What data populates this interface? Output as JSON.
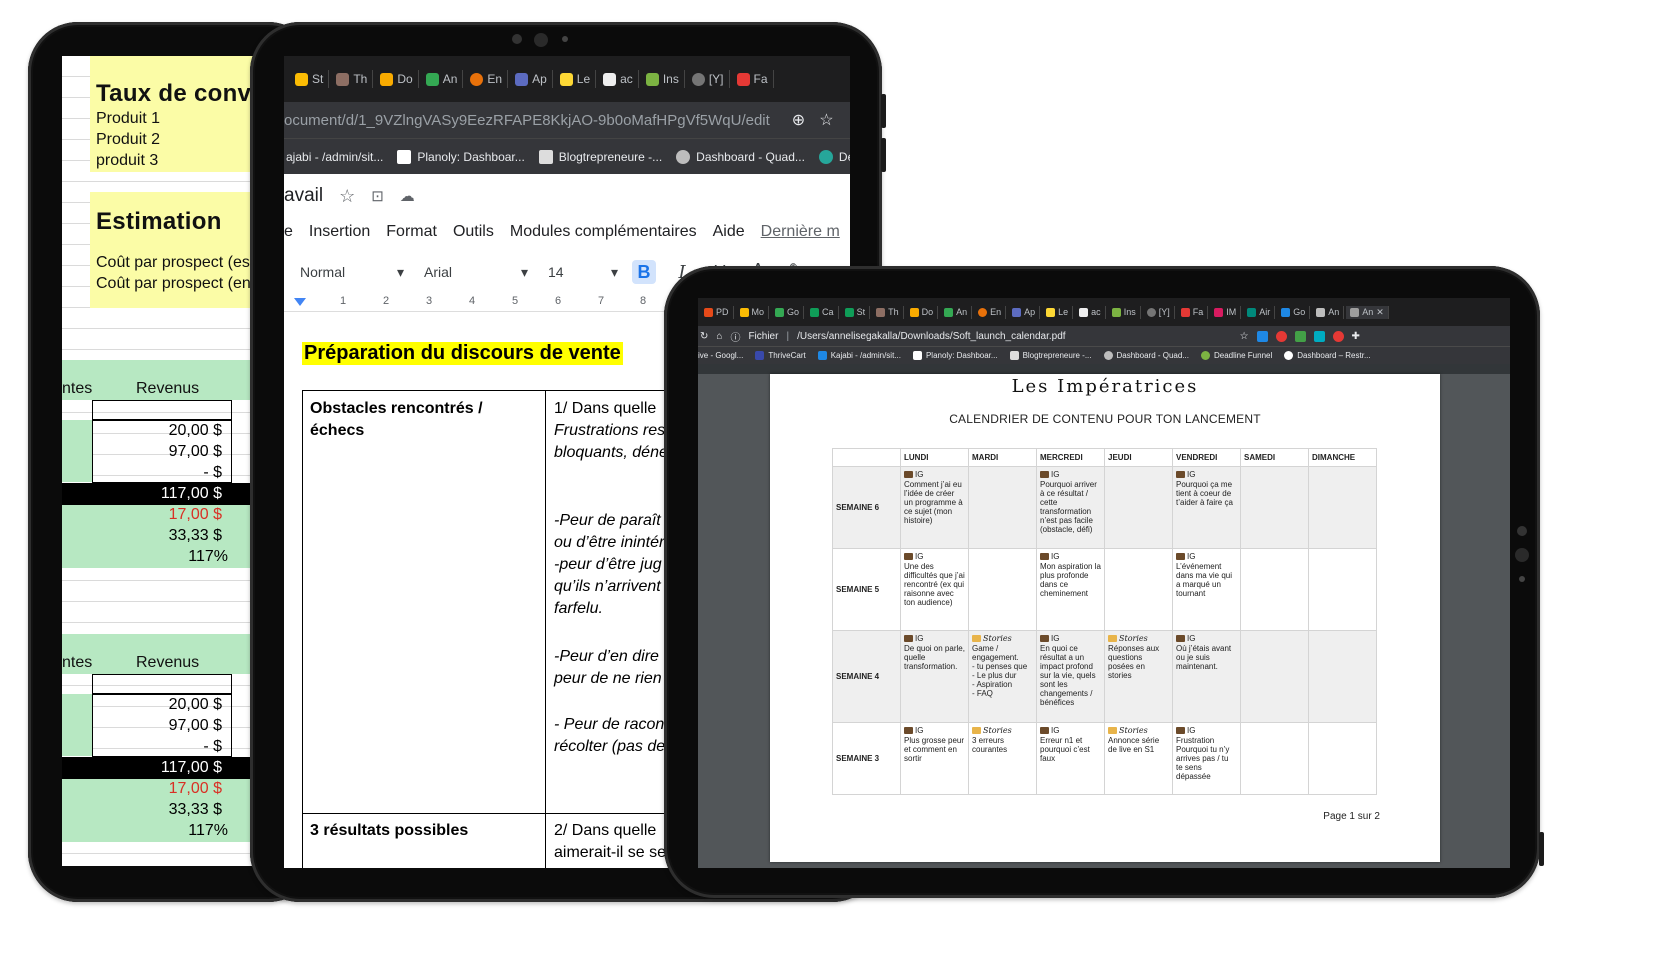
{
  "spreadsheet": {
    "heading_taux": "Taux de conve",
    "products": [
      "Produit 1",
      "Produit 2",
      "produit 3"
    ],
    "heading_estimation": "Estimation",
    "cost_lines": [
      "Coût par prospect (esti",
      "Coût par prospect (en"
    ],
    "table1": {
      "col_left": "ntes",
      "col_revenus": "Revenus",
      "values": [
        "20,00 $",
        "97,00 $",
        "-      $"
      ],
      "total": "117,00 $",
      "red": "17,00 $",
      "avg": "33,33 $",
      "pct": "117%"
    },
    "table2": {
      "col_left": "ntes",
      "col_revenus": "Revenus",
      "values": [
        "20,00 $",
        "97,00 $",
        "-      $"
      ],
      "total": "117,00 $",
      "red": "17,00 $",
      "avg": "33,33 $",
      "pct": "117%"
    }
  },
  "gdocs": {
    "tabs": [
      "St",
      "Th",
      "Do",
      "An",
      "En",
      "Ap",
      "Le",
      "ac",
      "Ins",
      "[Y]",
      "Fa"
    ],
    "url": "ocument/d/1_9VZlngVASy9EezRFAPE8KkjAO-9b0oMafHPgVf5WqU/edit",
    "bookmarks": [
      "ajabi - /admin/sit...",
      "Planoly: Dashboar...",
      "Blogtrepreneure -...",
      "Dashboard - Quad...",
      "Dea"
    ],
    "doc_title": "avail",
    "menu": [
      "e",
      "Insertion",
      "Format",
      "Outils",
      "Modules complémentaires",
      "Aide",
      "Dernière m"
    ],
    "style_select": "Normal",
    "font_select": "Arial",
    "size_select": "14",
    "ruler": [
      "1",
      "2",
      "3",
      "4",
      "5",
      "6",
      "7",
      "8"
    ],
    "heading": "Préparation du discours de vente",
    "row1_left": "Obstacles rencontrés /\néchecs",
    "row1_right_a": "1/ Dans quelle",
    "row1_right_b": "Frustrations res\nbloquants, déne",
    "row1_right_c": "-Peur de paraît\nou d’être inintér\n-peur d’être jug\nqu’ils n’arrivent\nfarfelu.",
    "row1_right_d": "-Peur d’en dire\npeur de ne rien",
    "row1_right_e": "- Peur de racon\nrécolter (pas de",
    "row2_left": "3 résultats possibles",
    "row2_right": "2/ Dans quelle\naimerait-il se se"
  },
  "pdf": {
    "tabs": [
      "PD",
      "Mo",
      "Go",
      "Ca",
      "St",
      "Th",
      "Do",
      "An",
      "En",
      "Ap",
      "Le",
      "ac",
      "Ins",
      "[Y]",
      "Fa",
      "IM",
      "Air",
      "Go",
      "An",
      "An"
    ],
    "url_label": "Fichier",
    "url": "/Users/annelisegakalla/Downloads/Soft_launch_calendar.pdf",
    "bookmarks": [
      "ive - Googl...",
      "ThriveCart",
      "Kajabi - /admin/sit...",
      "Planoly: Dashboar...",
      "Blogtrepreneure -...",
      "Dashboard - Quad...",
      "Deadline Funnel",
      "Dashboard – Restr..."
    ],
    "brand": "Les Impératrices",
    "subtitle": "CALENDRIER DE CONTENU POUR TON LANCEMENT",
    "days": [
      "LUNDI",
      "MARDI",
      "MERCREDI",
      "JEUDI",
      "VENDREDI",
      "SAMEDI",
      "DIMANCHE"
    ],
    "weeks": [
      {
        "label": "SEMAINE 6",
        "cells": [
          {
            "tag": "IG",
            "text": "Comment j’ai eu l’idée de créer un programme à ce sujet (mon histoire)"
          },
          {
            "tag": "",
            "text": ""
          },
          {
            "tag": "IG",
            "text": "Pourquoi arriver à ce résultat / cette transformation n’est pas facile (obstacle, défi)"
          },
          {
            "tag": "",
            "text": ""
          },
          {
            "tag": "IG",
            "text": "Pourquoi ça me tient à coeur de t’aider à faire ça"
          },
          {
            "tag": "",
            "text": ""
          },
          {
            "tag": "",
            "text": ""
          }
        ]
      },
      {
        "label": "SEMAINE 5",
        "cells": [
          {
            "tag": "IG",
            "text": "Une des difficultés que j’ai rencontré (ex qui raisonne avec ton audience)"
          },
          {
            "tag": "",
            "text": ""
          },
          {
            "tag": "IG",
            "text": "Mon aspiration la plus profonde dans ce cheminement"
          },
          {
            "tag": "",
            "text": ""
          },
          {
            "tag": "IG",
            "text": "L’événement dans ma vie qui a marqué un tournant"
          },
          {
            "tag": "",
            "text": ""
          },
          {
            "tag": "",
            "text": ""
          }
        ]
      },
      {
        "label": "SEMAINE 4",
        "cells": [
          {
            "tag": "IG",
            "text": "De quoi on parle, quelle transformation."
          },
          {
            "tag": "Stories",
            "text": "Game / engagement.\n - tu penses que\n - Le plus dur\n - Aspiration\n - FAQ"
          },
          {
            "tag": "IG",
            "text": "En quoi ce résultat a un impact profond sur la vie, quels sont les changements / bénéfices"
          },
          {
            "tag": "Stories",
            "text": "Réponses aux questions posées en stories"
          },
          {
            "tag": "IG",
            "text": "Où j’étais avant ou je suis maintenant."
          },
          {
            "tag": "",
            "text": ""
          },
          {
            "tag": "",
            "text": ""
          }
        ]
      },
      {
        "label": "SEMAINE 3",
        "cells": [
          {
            "tag": "IG",
            "text": "Plus grosse peur et comment en sortir"
          },
          {
            "tag": "Stories",
            "text": "3 erreurs courantes"
          },
          {
            "tag": "IG",
            "text": "Erreur n1 et pourquoi c’est faux"
          },
          {
            "tag": "Stories",
            "text": "Annonce série de live en S1"
          },
          {
            "tag": "IG",
            "text": "Frustration Pourquoi tu n’y arrives pas / tu te sens dépassée"
          },
          {
            "tag": "",
            "text": ""
          },
          {
            "tag": "",
            "text": ""
          }
        ]
      }
    ],
    "footer": "Page 1 sur 2"
  }
}
